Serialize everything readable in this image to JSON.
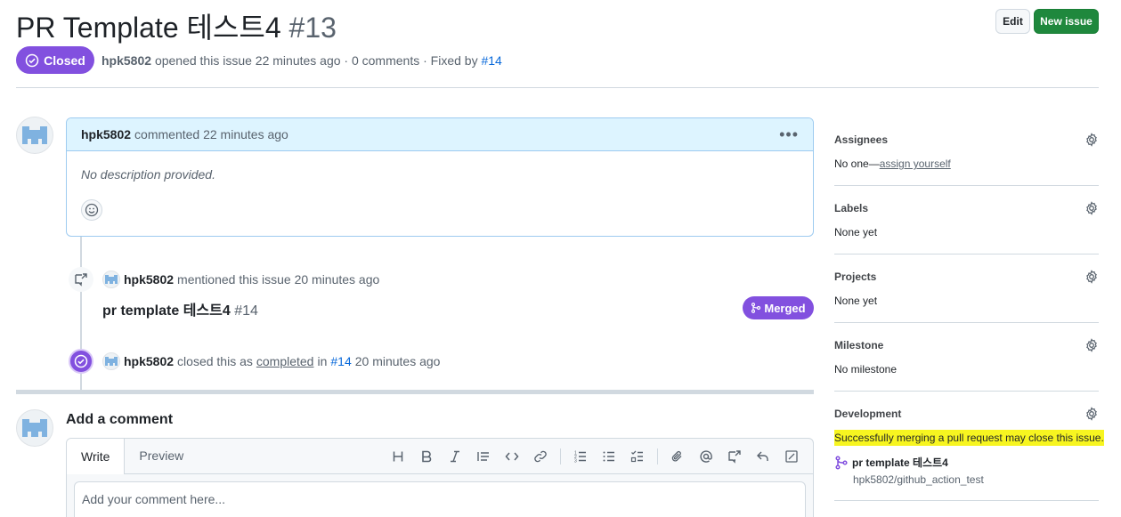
{
  "header": {
    "title": "PR Template 테스트4",
    "number": "#13",
    "edit_label": "Edit",
    "new_issue_label": "New issue",
    "state": "Closed",
    "author": "hpk5802",
    "opened_text": "opened this issue 22 minutes ago · 0 comments · Fixed by",
    "fixed_by": "#14"
  },
  "comment": {
    "author": "hpk5802",
    "time_text": "commented 22 minutes ago",
    "body": "No description provided."
  },
  "events": {
    "mention": {
      "author": "hpk5802",
      "text": "mentioned this issue 20 minutes ago",
      "ref_title": "pr template 테스트4",
      "ref_number": "#14",
      "badge": "Merged"
    },
    "closed": {
      "author": "hpk5802",
      "text_before": "closed this as",
      "completed": "completed",
      "in": "in",
      "ref": "#14",
      "time": "20 minutes ago"
    }
  },
  "add_comment": {
    "title": "Add a comment",
    "tab_write": "Write",
    "tab_preview": "Preview",
    "placeholder": "Add your comment here..."
  },
  "sidebar": {
    "assignees": {
      "label": "Assignees",
      "value_prefix": "No one—",
      "link": "assign yourself"
    },
    "labels": {
      "label": "Labels",
      "value": "None yet"
    },
    "projects": {
      "label": "Projects",
      "value": "None yet"
    },
    "milestone": {
      "label": "Milestone",
      "value": "No milestone"
    },
    "development": {
      "label": "Development",
      "note": "Successfully merging a pull request may close this issue.",
      "pr_title": "pr template 테스트4",
      "repo": "hpk5802/github_action_test"
    }
  },
  "colors": {
    "purple": "#8250df",
    "green": "#1f883d",
    "link": "#0969da",
    "highlight": "#f7f520",
    "comment_header": "#ddf4ff"
  }
}
